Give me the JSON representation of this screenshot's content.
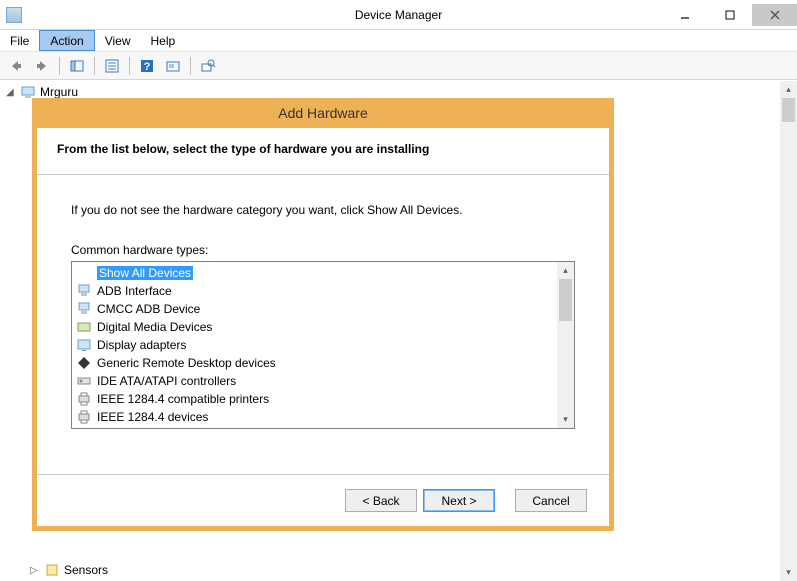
{
  "window": {
    "title": "Device Manager"
  },
  "menubar": {
    "items": [
      "File",
      "Action",
      "View",
      "Help"
    ],
    "active_index": 1
  },
  "tree": {
    "root": "Mrguru",
    "visible_child": "Sensors"
  },
  "wizard": {
    "title": "Add Hardware",
    "heading": "From the list below, select the type of hardware you are installing",
    "note": "If you do not see the hardware category you want, click Show All Devices.",
    "list_label": "Common hardware types:",
    "items": [
      "Show All Devices",
      "ADB Interface",
      "CMCC ADB Device",
      "Digital Media Devices",
      "Display adapters",
      "Generic Remote Desktop devices",
      "IDE ATA/ATAPI controllers",
      "IEEE 1284.4 compatible printers",
      "IEEE 1284.4 devices"
    ],
    "selected_index": 0,
    "buttons": {
      "back": "< Back",
      "next": "Next >",
      "cancel": "Cancel"
    }
  }
}
